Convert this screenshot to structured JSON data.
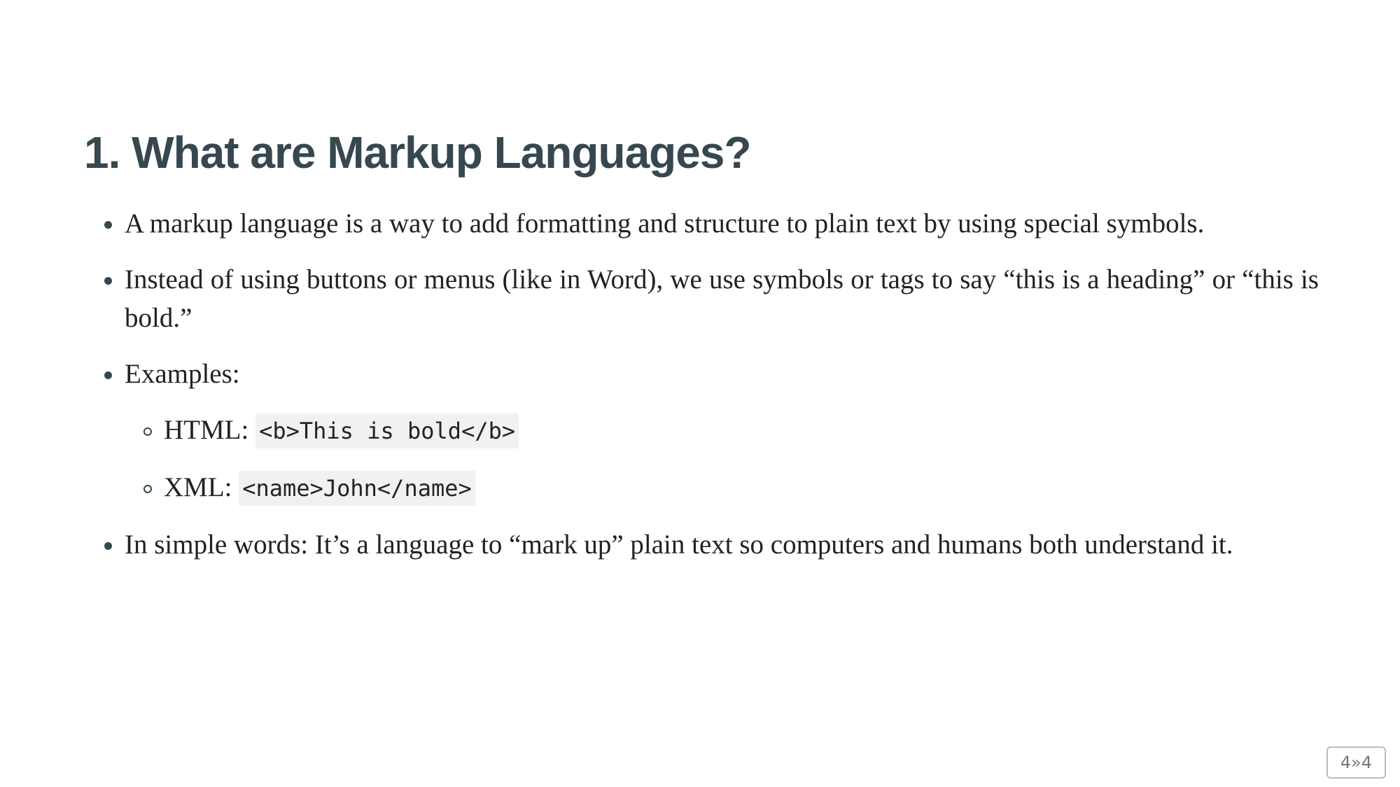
{
  "slide": {
    "title": "1. What are Markup Languages?",
    "bullets": [
      "A markup language is a way to add formatting and structure to plain text by using special symbols.",
      "Instead of using buttons or menus (like in Word), we use symbols or tags to say “this is a heading” or “this is bold.”",
      "Examples:",
      "In simple words: It’s a language to “mark up” plain text so computers and humans both understand it."
    ],
    "examples": [
      {
        "label": "HTML:",
        "code": "<b>This is bold</b>"
      },
      {
        "label": "XML:",
        "code": "<name>John</name>"
      }
    ]
  },
  "page_indicator": "4»4"
}
